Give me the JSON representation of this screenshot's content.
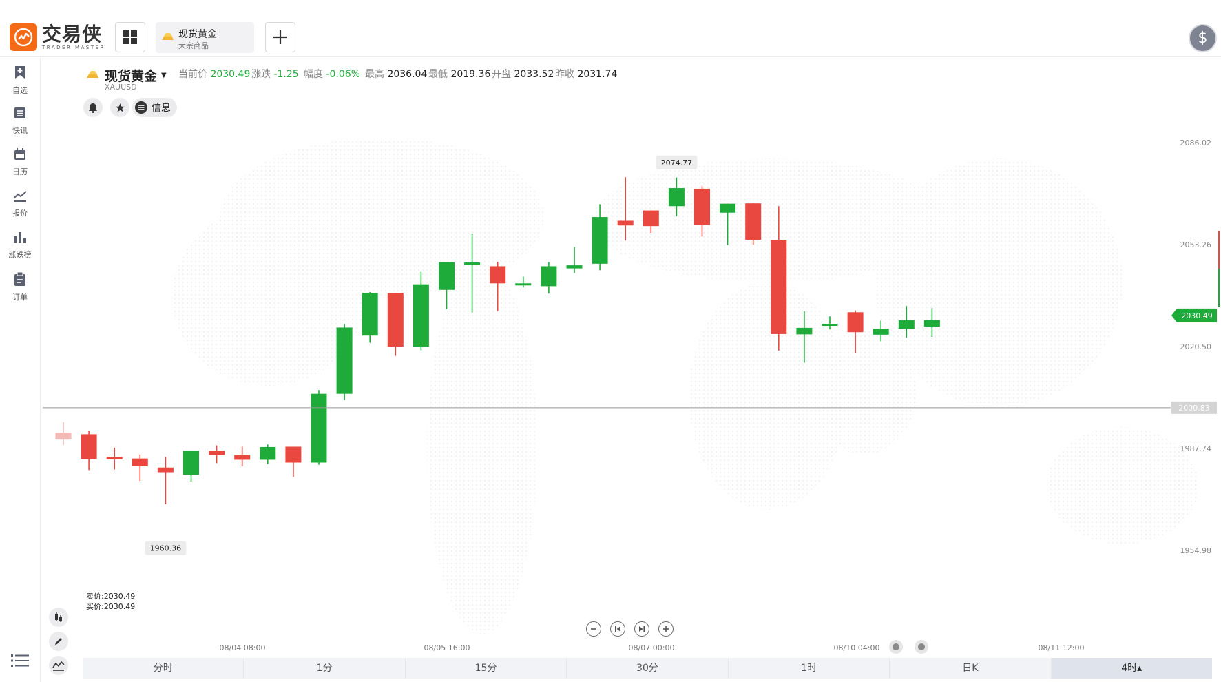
{
  "app": {
    "logo_cn": "交易侠",
    "logo_en": "TRADER MASTER"
  },
  "tabs": [
    {
      "title": "现货黄金",
      "subtitle": "大宗商品",
      "icon": "gold-bar-icon"
    }
  ],
  "sidebar": {
    "items": [
      {
        "label": "自选",
        "icon": "bookmark-plus-icon"
      },
      {
        "label": "快讯",
        "icon": "news-list-icon"
      },
      {
        "label": "日历",
        "icon": "calendar-icon"
      },
      {
        "label": "报价",
        "icon": "line-chart-icon"
      },
      {
        "label": "涨跌榜",
        "icon": "bar-chart-icon"
      },
      {
        "label": "订单",
        "icon": "clipboard-icon"
      }
    ],
    "menu_icon": "menu-list-icon"
  },
  "symbol": {
    "name": "现货黄金",
    "code": "XAUUSD",
    "quotes": [
      {
        "label": "当前价",
        "value": "2030.49",
        "color": "#1fab3a"
      },
      {
        "label": "涨跌",
        "value": "-1.25",
        "color": "#1fab3a"
      },
      {
        "label": "幅度",
        "value": "-0.06%",
        "color": "#1fab3a"
      },
      {
        "label": "最高",
        "value": "2036.04",
        "color": "#222222"
      },
      {
        "label": "最低",
        "value": "2019.36",
        "color": "#222222"
      },
      {
        "label": "开盘",
        "value": "2033.52",
        "color": "#222222"
      },
      {
        "label": "昨收",
        "value": "2031.74",
        "color": "#222222"
      }
    ],
    "info_label": "信息"
  },
  "bid_ask": {
    "sell": "卖价:2030.49",
    "buy": "买价:2030.49"
  },
  "periods": [
    {
      "label": "分时",
      "active": false
    },
    {
      "label": "1分",
      "active": false
    },
    {
      "label": "15分",
      "active": false
    },
    {
      "label": "30分",
      "active": false
    },
    {
      "label": "1时",
      "active": false
    },
    {
      "label": "日K",
      "active": false
    },
    {
      "label": "4时▴",
      "active": true
    }
  ],
  "colors": {
    "up": "#1fab3a",
    "down": "#e8483f",
    "accent": "#f56a16"
  },
  "chart_data": {
    "type": "candlestick",
    "y_ticks": [
      2086.02,
      2053.26,
      2020.5,
      1987.74,
      1954.98
    ],
    "x_tick_labels": [
      "08/04 08:00",
      "08/05 16:00",
      "08/07 00:00",
      "08/10 04:00",
      "08/11 12:00"
    ],
    "current_price": "2030.49",
    "crosshair_price": "2000.83",
    "max_label": "2074.77",
    "min_label": "1960.36",
    "ylim": [
      1946,
      2096
    ],
    "candles": [
      {
        "o": 1992.8,
        "h": 1996.2,
        "l": 1988.8,
        "c": 1990.8,
        "faded": true
      },
      {
        "o": 1992.3,
        "h": 1993.5,
        "l": 1980.8,
        "c": 1984.3
      },
      {
        "o": 1985.0,
        "h": 1988.0,
        "l": 1981.0,
        "c": 1984.2
      },
      {
        "o": 1984.5,
        "h": 1985.8,
        "l": 1977.3,
        "c": 1982.0
      },
      {
        "o": 1981.6,
        "h": 1985.0,
        "l": 1969.8,
        "c": 1980.1
      },
      {
        "o": 1979.3,
        "h": 1987.0,
        "l": 1977.1,
        "c": 1987.0
      },
      {
        "o": 1987.0,
        "h": 1988.7,
        "l": 1983.0,
        "c": 1985.6
      },
      {
        "o": 1985.7,
        "h": 1988.3,
        "l": 1982.0,
        "c": 1984.1
      },
      {
        "o": 1984.1,
        "h": 1989.0,
        "l": 1982.7,
        "c": 1988.2
      },
      {
        "o": 1988.3,
        "h": 1988.3,
        "l": 1978.6,
        "c": 1983.2
      },
      {
        "o": 1983.2,
        "h": 2006.5,
        "l": 1982.5,
        "c": 2005.3
      },
      {
        "o": 2005.3,
        "h": 2027.8,
        "l": 2003.3,
        "c": 2026.6
      },
      {
        "o": 2024.0,
        "h": 2038.0,
        "l": 2021.7,
        "c": 2037.7
      },
      {
        "o": 2037.7,
        "h": 2037.7,
        "l": 2017.5,
        "c": 2020.5
      },
      {
        "o": 2020.5,
        "h": 2044.5,
        "l": 2019.3,
        "c": 2040.5
      },
      {
        "o": 2038.7,
        "h": 2042.0,
        "l": 2032.5,
        "c": 2047.6
      },
      {
        "o": 2047.0,
        "h": 2056.8,
        "l": 2031.4,
        "c": 2047.5
      },
      {
        "o": 2046.3,
        "h": 2047.7,
        "l": 2031.9,
        "c": 2040.8
      },
      {
        "o": 2040.8,
        "h": 2043.0,
        "l": 2039.5,
        "c": 2040.8
      },
      {
        "o": 2039.9,
        "h": 2047.6,
        "l": 2037.5,
        "c": 2046.3
      },
      {
        "o": 2045.6,
        "h": 2052.5,
        "l": 2044.1,
        "c": 2046.6
      },
      {
        "o": 2047.1,
        "h": 2066.2,
        "l": 2045.0,
        "c": 2062.1
      },
      {
        "o": 2060.9,
        "h": 2074.9,
        "l": 2054.6,
        "c": 2059.4
      },
      {
        "o": 2064.2,
        "h": 2064.2,
        "l": 2057.0,
        "c": 2059.2
      },
      {
        "o": 2065.6,
        "h": 2074.8,
        "l": 2062.3,
        "c": 2071.4
      },
      {
        "o": 2071.2,
        "h": 2072.0,
        "l": 2055.8,
        "c": 2059.6
      },
      {
        "o": 2063.5,
        "h": 2066.4,
        "l": 2053.1,
        "c": 2066.4
      },
      {
        "o": 2066.5,
        "h": 2066.5,
        "l": 2053.2,
        "c": 2054.8
      },
      {
        "o": 2054.8,
        "h": 2065.6,
        "l": 2019.2,
        "c": 2024.5
      },
      {
        "o": 2024.4,
        "h": 2031.8,
        "l": 2015.3,
        "c": 2026.5
      },
      {
        "o": 2027.3,
        "h": 2030.2,
        "l": 2026.0,
        "c": 2027.8
      },
      {
        "o": 2031.5,
        "h": 2032.1,
        "l": 2018.5,
        "c": 2025.1
      },
      {
        "o": 2024.3,
        "h": 2028.8,
        "l": 2022.2,
        "c": 2026.2
      },
      {
        "o": 2026.2,
        "h": 2033.5,
        "l": 2023.3,
        "c": 2028.9
      },
      {
        "o": 2026.9,
        "h": 2032.8,
        "l": 2023.6,
        "c": 2029.0
      }
    ]
  }
}
